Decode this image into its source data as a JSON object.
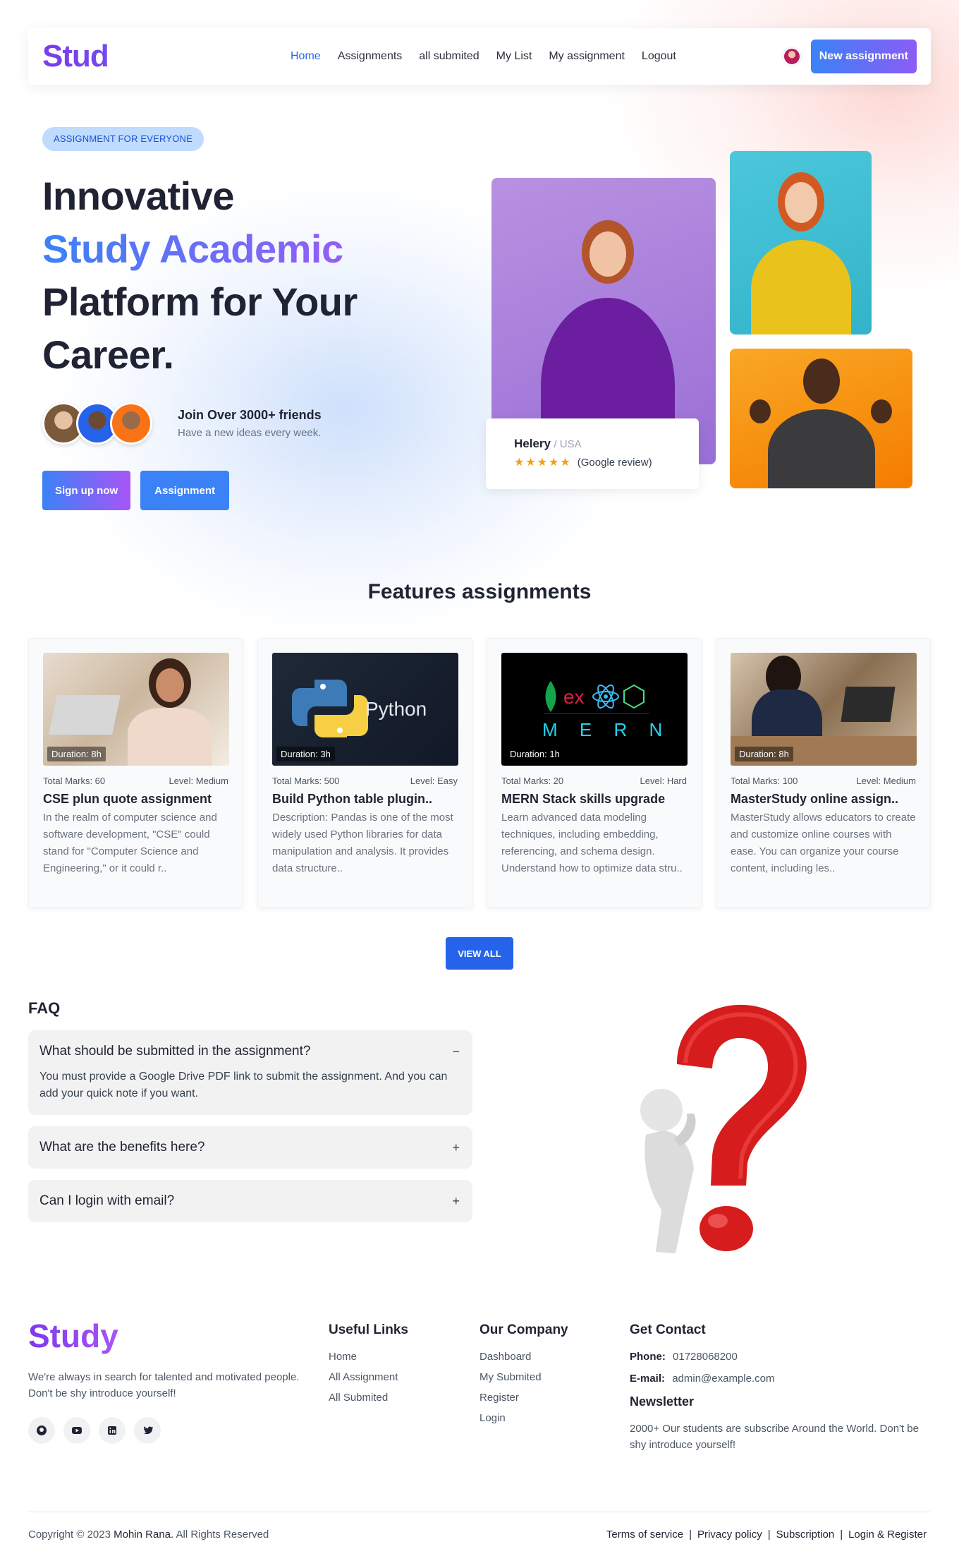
{
  "nav": {
    "logo": "Stud",
    "links": [
      {
        "label": "Home",
        "active": true
      },
      {
        "label": "Assignments",
        "active": false
      },
      {
        "label": "all submited",
        "active": false
      },
      {
        "label": "My List",
        "active": false
      },
      {
        "label": "My assignment",
        "active": false
      },
      {
        "label": "Logout",
        "active": false
      }
    ],
    "new_assignment_label": "New assignment"
  },
  "hero": {
    "badge": "ASSIGNMENT FOR EVERYONE",
    "title_line1": "Innovative",
    "title_line2": "Study Academic",
    "title_line3": "Platform for Your",
    "title_line4": "Career.",
    "friends_title": "Join Over 3000+ friends",
    "friends_sub": "Have a new ideas every week.",
    "signup_label": "Sign up now",
    "assignment_label": "Assignment",
    "review": {
      "name": "Helery",
      "country": "/ USA",
      "stars": "★★★★★",
      "source": "(Google review)"
    }
  },
  "features": {
    "title": "Features assignments",
    "cards": [
      {
        "duration": "Duration: 8h",
        "marks": "Total Marks: 60",
        "level": "Level: Medium",
        "title": "CSE plun quote assignment",
        "desc": "In the realm of computer science and software development, \"CSE\" could stand for \"Computer Science and Engineering,\" or it could r.."
      },
      {
        "duration": "Duration: 3h",
        "marks": "Total Marks: 500",
        "level": "Level: Easy",
        "title": "Build Python table plugin..",
        "desc": "Description: Pandas is one of the most widely used Python libraries for data manipulation and analysis. It provides data structure..",
        "thumb_text": "Python"
      },
      {
        "duration": "Duration: 1h",
        "marks": "Total Marks: 20",
        "level": "Level: Hard",
        "title": "MERN Stack skills upgrade",
        "desc": "Learn advanced data modeling techniques, including embedding, referencing, and schema design. Understand how to optimize data stru..",
        "thumb_text": "M E R N"
      },
      {
        "duration": "Duration: 8h",
        "marks": "Total Marks: 100",
        "level": "Level: Medium",
        "title": "MasterStudy online assign..",
        "desc": "MasterStudy allows educators to create and customize online courses with ease. You can organize your course content, including les.."
      }
    ],
    "view_all_label": "VIEW ALL"
  },
  "faq": {
    "heading": "FAQ",
    "items": [
      {
        "q": "What should be submitted in the assignment?",
        "sign": "−",
        "a": "You must provide a Google Drive PDF link to submit the assignment. And you can add your quick note if you want."
      },
      {
        "q": "What are the benefits here?",
        "sign": "+"
      },
      {
        "q": "Can I login with email?",
        "sign": "+"
      }
    ]
  },
  "footer": {
    "logo": "Study",
    "about": "We're always in search for talented and motivated people. Don't be shy introduce yourself!",
    "socials": [
      "github-icon",
      "youtube-icon",
      "linkedin-icon",
      "twitter-icon"
    ],
    "useful_links": {
      "title": "Useful Links",
      "links": [
        "Home",
        "All Assignment",
        "All Submited"
      ]
    },
    "company": {
      "title": "Our Company",
      "links": [
        "Dashboard",
        "My Submited",
        "Register",
        "Login"
      ]
    },
    "contact": {
      "title": "Get Contact",
      "phone_label": "Phone:",
      "phone": "01728068200",
      "email_label": "E-mail:",
      "email": "admin@example.com",
      "newsletter_title": "Newsletter",
      "newsletter_text": "2000+ Our students are subscribe Around the World. Don't be shy introduce yourself!"
    },
    "copyright_prefix": "Copyright © 2023",
    "copyright_name": "Mohin Rana.",
    "copyright_suffix": "All Rights Reserved",
    "legal": [
      "Terms of service",
      "Privacy policy",
      "Subscription",
      "Login & Register"
    ]
  },
  "colors": {
    "brand_purple": "#7c3aed",
    "primary_blue": "#2563eb",
    "star": "#f59e0b"
  }
}
